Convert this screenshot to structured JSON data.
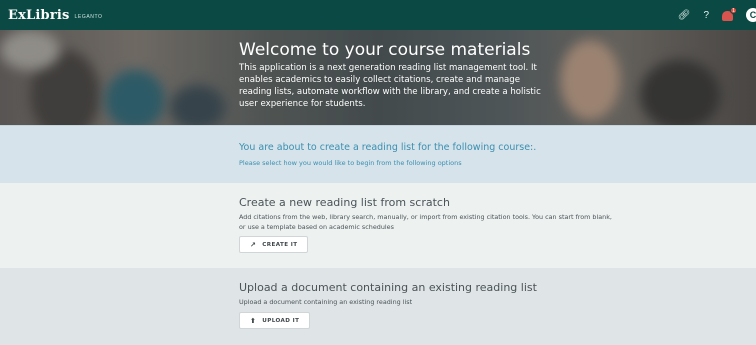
{
  "header": {
    "logo": "ExLibris",
    "logo_sub": "LEGANTO",
    "icons": [
      "link-icon",
      "help-icon",
      "notifications-icon",
      "user-menu-icon"
    ],
    "help_label": "?",
    "notification_count": "1",
    "user_initial": "C"
  },
  "hero": {
    "title": "Welcome to your course materials",
    "text": "This application is a next generation reading list management tool. It enables academics to easily collect citations, create and manage reading lists, automate workflow with the library, and create a holistic user experience for students."
  },
  "course": {
    "title": "You are about to create a reading list for the following course:.",
    "subtitle": "Please select how you would like to begin from the following options"
  },
  "create": {
    "title": "Create a new reading list from scratch",
    "description": "Add citations from the web, library search, manually, or import from existing citation tools. You can start from blank, or use a template based on academic schedules",
    "button": "CREATE IT"
  },
  "upload": {
    "title": "Upload a document containing an existing reading list",
    "description": "Upload a document containing an existing reading list",
    "button": "UPLOAD IT"
  },
  "colors": {
    "topbar": "#0b4a44",
    "link_blue": "#3a8fb0",
    "course_bg": "#d6e3ea",
    "create_bg": "#edf2f1",
    "upload_bg": "#dfe5e7"
  }
}
